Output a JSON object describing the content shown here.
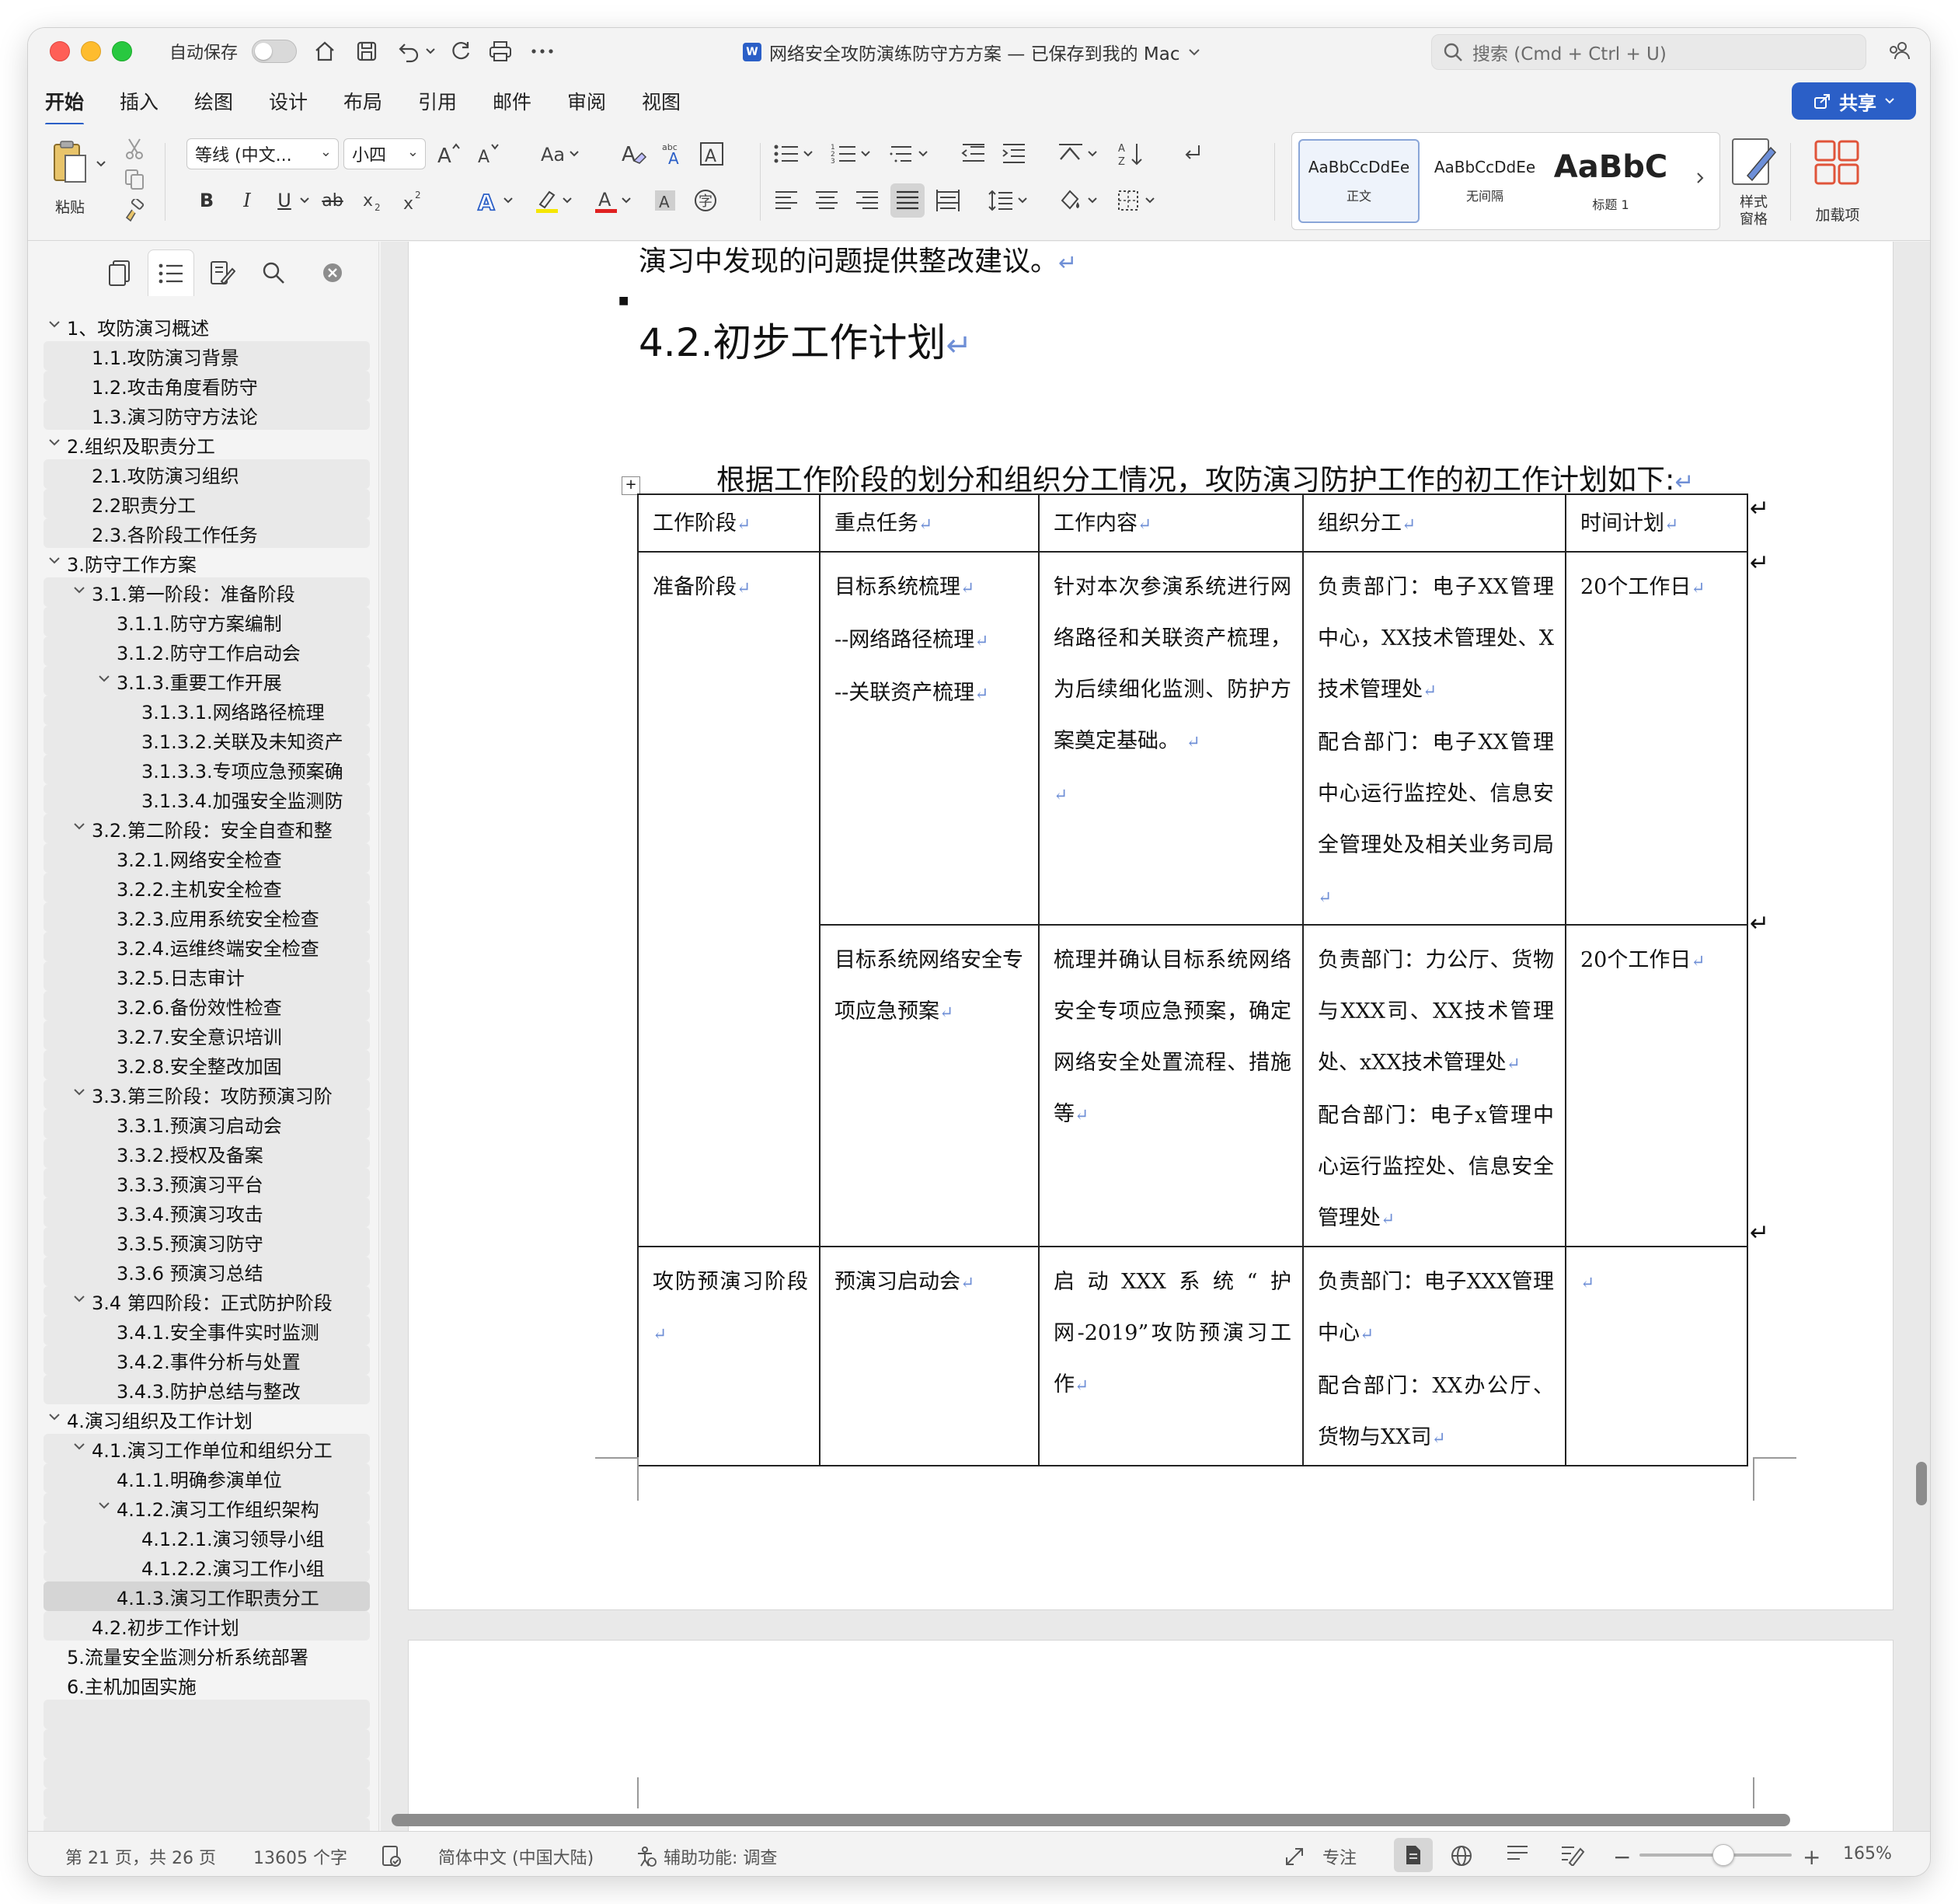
{
  "titlebar": {
    "autosave_label": "自动保存",
    "doc_title": "网络安全攻防演练防守方方案 — 已保存到我的 Mac",
    "search_placeholder": "搜索 (Cmd + Ctrl + U)"
  },
  "tabs": [
    "开始",
    "插入",
    "绘图",
    "设计",
    "布局",
    "引用",
    "邮件",
    "审阅",
    "视图"
  ],
  "share_label": "共享",
  "ribbon": {
    "paste_label": "粘贴",
    "font_name": "等线 (中文...",
    "font_size": "小四",
    "styles": [
      {
        "preview": "AaBbCcDdEe",
        "caption": "正文"
      },
      {
        "preview": "AaBbCcDdEe",
        "caption": "无间隔"
      },
      {
        "preview": "AaBbC",
        "caption": "标题 1"
      }
    ],
    "styles_pane_label": "样式\n窗格",
    "styles_pane_line1": "样式",
    "styles_pane_line2": "窗格",
    "addins_label": "加载项"
  },
  "nav": {
    "items": [
      {
        "label": "1、攻防演习概述",
        "level": 0,
        "caret": true
      },
      {
        "label": "1.1.攻防演习背景",
        "level": 1,
        "caret": false
      },
      {
        "label": "1.2.攻击角度看防守",
        "level": 1,
        "caret": false
      },
      {
        "label": "1.3.演习防守方法论",
        "level": 1,
        "caret": false
      },
      {
        "label": "2.组织及职责分工",
        "level": 0,
        "caret": true
      },
      {
        "label": "2.1.攻防演习组织",
        "level": 1,
        "caret": false
      },
      {
        "label": "2.2职责分工",
        "level": 1,
        "caret": false
      },
      {
        "label": "2.3.各阶段工作任务",
        "level": 1,
        "caret": false
      },
      {
        "label": "3.防守工作方案",
        "level": 0,
        "caret": true
      },
      {
        "label": "3.1.第一阶段：准备阶段",
        "level": 1,
        "caret": true
      },
      {
        "label": "3.1.1.防守方案编制",
        "level": 2,
        "caret": false
      },
      {
        "label": "3.1.2.防守工作启动会",
        "level": 2,
        "caret": false
      },
      {
        "label": "3.1.3.重要工作开展",
        "level": 2,
        "caret": true
      },
      {
        "label": "3.1.3.1.网络路径梳理",
        "level": 3,
        "caret": false
      },
      {
        "label": "3.1.3.2.关联及未知资产",
        "level": 3,
        "caret": false
      },
      {
        "label": "3.1.3.3.专项应急预案确",
        "level": 3,
        "caret": false
      },
      {
        "label": "3.1.3.4.加强安全监测防",
        "level": 3,
        "caret": false
      },
      {
        "label": "3.2.第二阶段：安全自查和整",
        "level": 1,
        "caret": true
      },
      {
        "label": "3.2.1.网络安全检查",
        "level": 2,
        "caret": false
      },
      {
        "label": "3.2.2.主机安全检查",
        "level": 2,
        "caret": false
      },
      {
        "label": "3.2.3.应用系统安全检查",
        "level": 2,
        "caret": false
      },
      {
        "label": "3.2.4.运维终端安全检查",
        "level": 2,
        "caret": false
      },
      {
        "label": "3.2.5.日志审计",
        "level": 2,
        "caret": false
      },
      {
        "label": "3.2.6.备份效性检查",
        "level": 2,
        "caret": false
      },
      {
        "label": "3.2.7.安全意识培训",
        "level": 2,
        "caret": false
      },
      {
        "label": "3.2.8.安全整改加固",
        "level": 2,
        "caret": false
      },
      {
        "label": "3.3.第三阶段：攻防预演习阶",
        "level": 1,
        "caret": true
      },
      {
        "label": "3.3.1.预演习启动会",
        "level": 2,
        "caret": false
      },
      {
        "label": "3.3.2.授权及备案",
        "level": 2,
        "caret": false
      },
      {
        "label": "3.3.3.预演习平台",
        "level": 2,
        "caret": false
      },
      {
        "label": "3.3.4.预演习攻击",
        "level": 2,
        "caret": false
      },
      {
        "label": "3.3.5.预演习防守",
        "level": 2,
        "caret": false
      },
      {
        "label": "3.3.6 预演习总结",
        "level": 2,
        "caret": false
      },
      {
        "label": "3.4 第四阶段：正式防护阶段",
        "level": 1,
        "caret": true
      },
      {
        "label": "3.4.1.安全事件实时监测",
        "level": 2,
        "caret": false
      },
      {
        "label": "3.4.2.事件分析与处置",
        "level": 2,
        "caret": false
      },
      {
        "label": "3.4.3.防护总结与整改",
        "level": 2,
        "caret": false
      },
      {
        "label": "4.演习组织及工作计划",
        "level": 0,
        "caret": true
      },
      {
        "label": "4.1.演习工作单位和组织分工",
        "level": 1,
        "caret": true
      },
      {
        "label": "4.1.1.明确参演单位",
        "level": 2,
        "caret": false
      },
      {
        "label": "4.1.2.演习工作组织架构",
        "level": 2,
        "caret": true
      },
      {
        "label": "4.1.2.1.演习领导小组",
        "level": 3,
        "caret": false
      },
      {
        "label": "4.1.2.2.演习工作小组",
        "level": 3,
        "caret": false
      },
      {
        "label": "4.1.3.演习工作职责分工",
        "level": 2,
        "caret": false,
        "selected": true
      },
      {
        "label": "4.2.初步工作计划",
        "level": 1,
        "caret": false
      },
      {
        "label": "5.流量安全监测分析系统部署",
        "level": 0,
        "caret": false
      },
      {
        "label": "6.主机加固实施",
        "level": 0,
        "caret": false
      },
      {
        "label": "",
        "level": 0,
        "caret": false
      },
      {
        "label": "",
        "level": 0,
        "caret": false
      },
      {
        "label": "",
        "level": 0,
        "caret": false
      },
      {
        "label": "",
        "level": 0,
        "caret": false
      },
      {
        "label": "",
        "level": 0,
        "caret": false
      }
    ]
  },
  "document": {
    "top_line": "演习中发现的问题提供整改建议。",
    "heading": "4.2.初步工作计划",
    "intro": "根据工作阶段的划分和组织分工情况，攻防演习防护工作的初工作计划如下:",
    "return_mark": "↵",
    "table": {
      "headers": [
        "工作阶段",
        "重点任务",
        "工作内容",
        "组织分工",
        "时间计划"
      ],
      "rows": {
        "phase1": "准备阶段",
        "r1_task": [
          "目标系统梳理",
          "--网络路径梳理",
          "--关联资产梳理"
        ],
        "r1_content": "针对本次参演系统进行网络路径和关联资产梳理，为后续细化监测、防护方案奠定基础。",
        "r1_org_resp": "负责部门：电子XX管理中心，XX技术管理处、X技术管理处",
        "r1_org_coop": "配合部门：电子XX管理中心运行监控处、信息安全管理处及相关业务司局",
        "r1_time": "20个工作日",
        "r2_task": "目标系统网络安全专项应急预案",
        "r2_content": "梳理并确认目标系统网络安全专项应急预案，确定网络安全处置流程、措施等",
        "r2_org_resp": "负责部门：力公厅、货物与XXX司、XX技术管理处、xXX技术管理处",
        "r2_org_coop": "配合部门：电子x管理中心运行监控处、信息安全管理处",
        "r2_time": "20个工作日",
        "phase2": "攻防预演习阶段",
        "r3_task": "预演习启动会",
        "r3_content": "启动XXX系统“护网-2019”攻防预演习工作",
        "r3_org_resp": "负责部门：电子XXX管理中心",
        "r3_org_coop": "配合部门：XX办公厅、货物与XX司",
        "r3_time": ""
      }
    }
  },
  "statusbar": {
    "page": "第 21 页，共 26 页",
    "words": "13605 个字",
    "language": "简体中文 (中国大陆)",
    "accessibility": "辅助功能: 调查",
    "focus": "专注",
    "zoom": "165%",
    "zoom_level": 0.55
  }
}
